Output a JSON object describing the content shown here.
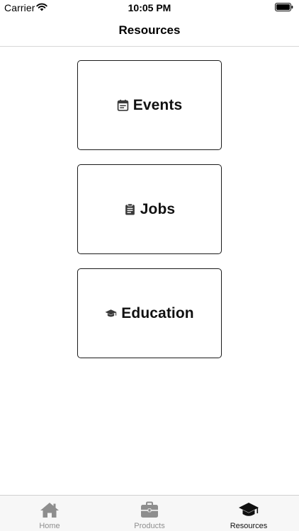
{
  "status_bar": {
    "carrier": "Carrier",
    "time": "10:05 PM"
  },
  "nav": {
    "title": "Resources"
  },
  "cards": [
    {
      "label": "Events",
      "icon": "calendar-icon"
    },
    {
      "label": "Jobs",
      "icon": "clipboard-icon"
    },
    {
      "label": "Education",
      "icon": "graduation-cap-icon"
    }
  ],
  "tab_bar": {
    "items": [
      {
        "label": "Home",
        "icon": "home-icon",
        "selected": false
      },
      {
        "label": "Products",
        "icon": "briefcase-icon",
        "selected": false
      },
      {
        "label": "Resources",
        "icon": "graduation-cap-icon",
        "selected": true
      }
    ]
  },
  "colors": {
    "tab_active": "#111111",
    "tab_inactive": "#8e8e8e",
    "card_border": "#1a1a1a"
  }
}
